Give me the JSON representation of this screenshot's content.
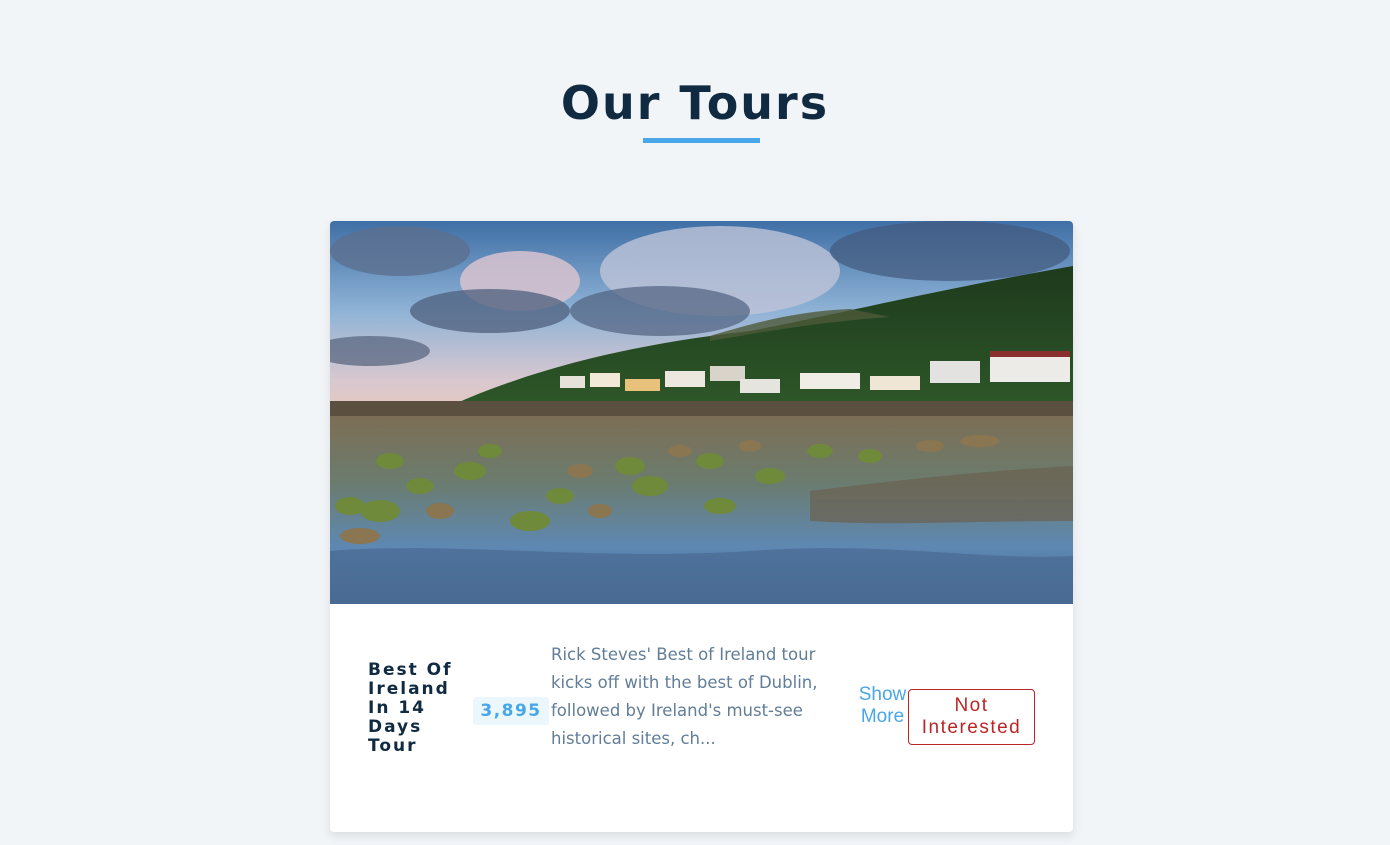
{
  "section": {
    "title": "Our Tours"
  },
  "tour": {
    "image": "ireland-coastline-photo",
    "name": "Best Of Ireland In 14 Days Tour",
    "price": "3,895",
    "description": "Rick Steves' Best of Ireland tour kicks off with the best of Dublin, followed by Ireland's must-see historical sites, ch...",
    "show_more_label": "Show More",
    "not_interested_label": "Not Interested"
  },
  "colors": {
    "background": "#f1f5f8",
    "heading": "#102a42",
    "accent": "#49a6e9",
    "price_bg": "#ebf7fd",
    "text_muted": "#617d98",
    "danger": "#bb2525"
  }
}
